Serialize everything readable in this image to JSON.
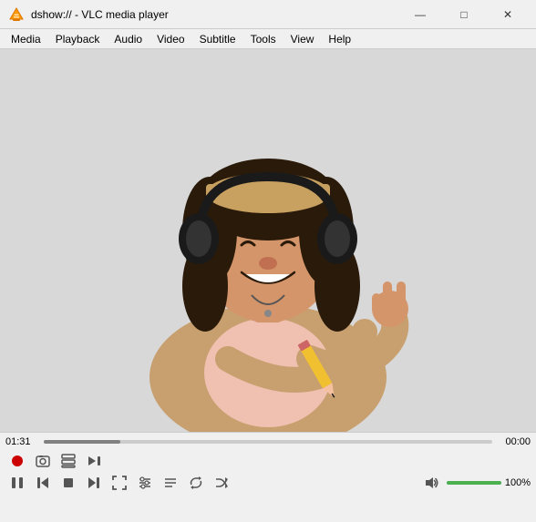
{
  "titlebar": {
    "icon": "🎭",
    "title": "dshow:// - VLC media player",
    "minimize": "—",
    "maximize": "□",
    "close": "✕"
  },
  "menubar": {
    "items": [
      "Media",
      "Playback",
      "Audio",
      "Video",
      "Subtitle",
      "Tools",
      "View",
      "Help"
    ]
  },
  "controls": {
    "time_elapsed": "01:31",
    "time_remaining": "00:00",
    "volume_pct": "100%",
    "progress_percent": 17,
    "volume_percent": 100
  },
  "buttons_row1": [
    {
      "name": "record-button",
      "label": "⏺",
      "title": "Record"
    },
    {
      "name": "snapshot-button",
      "label": "📷",
      "title": "Take snapshot"
    },
    {
      "name": "show-extended-button",
      "label": "🔀",
      "title": "Show extended settings"
    },
    {
      "name": "frame-by-frame-button",
      "label": "▶|",
      "title": "Frame by frame"
    }
  ],
  "buttons_row2": [
    {
      "name": "play-pause-button",
      "label": "⏸",
      "title": "Pause"
    },
    {
      "name": "stop-button",
      "label": "⏹",
      "title": "Stop"
    },
    {
      "name": "previous-button",
      "label": "⏮",
      "title": "Previous"
    },
    {
      "name": "next-button",
      "label": "⏭",
      "title": "Next"
    },
    {
      "name": "fullscreen-button",
      "label": "⛶",
      "title": "Fullscreen"
    },
    {
      "name": "extended-settings-button",
      "label": "🔧",
      "title": "Extended settings"
    },
    {
      "name": "playlist-button",
      "label": "☰",
      "title": "Playlist"
    },
    {
      "name": "loop-button",
      "label": "🔁",
      "title": "Loop"
    },
    {
      "name": "random-button",
      "label": "🔀",
      "title": "Random"
    }
  ]
}
